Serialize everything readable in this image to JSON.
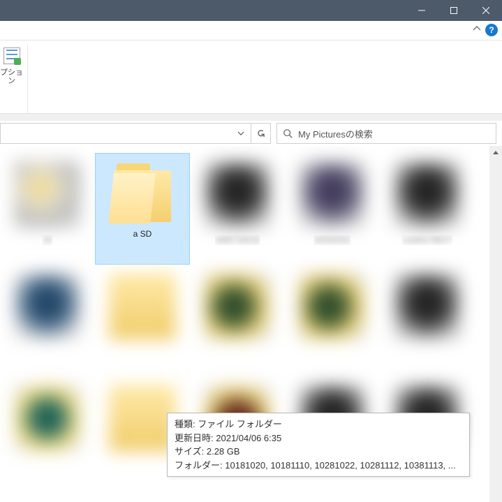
{
  "window": {
    "minimize": "minimize",
    "maximize": "maximize",
    "close": "close"
  },
  "help": "?",
  "ribbon": {
    "option_label": "プション"
  },
  "search": {
    "placeholder": "My Picturesの検索"
  },
  "folders": {
    "items": [
      {
        "name": "20",
        "style": "t1",
        "blurred": true,
        "selected": false,
        "is_folder": false
      },
      {
        "name": "a SD",
        "style": "",
        "blurred": false,
        "selected": true,
        "is_folder": true
      },
      {
        "name": "AMD DACB",
        "style": "g-dark",
        "blurred": true,
        "selected": false,
        "is_folder": false
      },
      {
        "name": "DDDDDD",
        "style": "g-purple",
        "blurred": true,
        "selected": false,
        "is_folder": false
      },
      {
        "name": "cod4ss 96GT",
        "style": "g-dark",
        "blurred": true,
        "selected": false,
        "is_folder": false
      },
      {
        "name": "",
        "style": "g-blue",
        "blurred": true,
        "selected": false,
        "is_folder": false
      },
      {
        "name": "",
        "style": "t3",
        "blurred": true,
        "selected": false,
        "is_folder": false
      },
      {
        "name": "",
        "style": "g-green",
        "blurred": true,
        "selected": false,
        "is_folder": false
      },
      {
        "name": "",
        "style": "g-green",
        "blurred": true,
        "selected": false,
        "is_folder": false
      },
      {
        "name": "",
        "style": "g-dark",
        "blurred": true,
        "selected": false,
        "is_folder": false
      },
      {
        "name": "",
        "style": "g-teal",
        "blurred": true,
        "selected": false,
        "is_folder": false
      },
      {
        "name": "",
        "style": "t3",
        "blurred": true,
        "selected": false,
        "is_folder": false
      },
      {
        "name": "",
        "style": "g-red",
        "blurred": true,
        "selected": false,
        "is_folder": false
      },
      {
        "name": "",
        "style": "g-dark",
        "blurred": true,
        "selected": false,
        "is_folder": false
      },
      {
        "name": "",
        "style": "g-dark",
        "blurred": true,
        "selected": false,
        "is_folder": false
      }
    ]
  },
  "tooltip": {
    "type_label": "種類:",
    "type_value": "ファイル フォルダー",
    "modified_label": "更新日時:",
    "modified_value": "2021/04/06 6:35",
    "size_label": "サイズ:",
    "size_value": "2.28 GB",
    "folders_label": "フォルダー:",
    "folders_value": "10181020, 10181110, 10281022, 10281112, 10381113, ..."
  }
}
